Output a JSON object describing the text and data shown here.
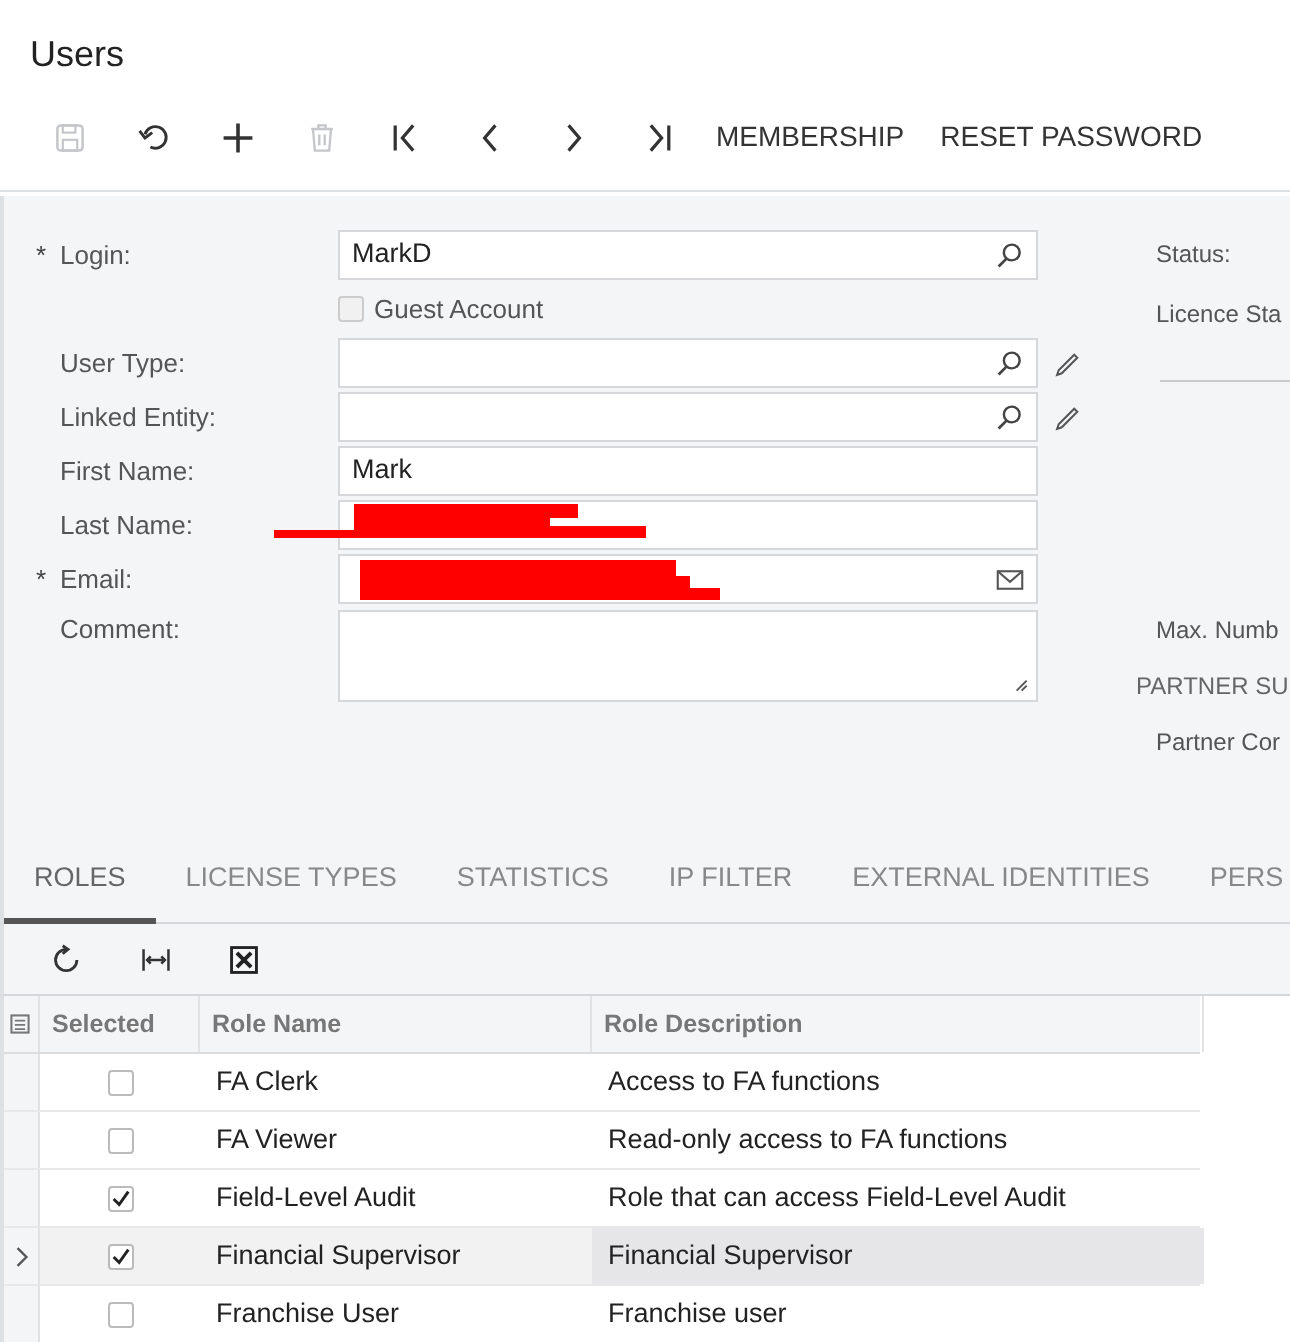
{
  "page_title": "Users",
  "toolbar": {
    "icon_buttons": [
      {
        "disabled": true
      },
      {
        "disabled": false
      },
      {
        "disabled": false
      },
      {
        "disabled": true
      },
      {
        "disabled": false
      },
      {
        "disabled": false
      },
      {
        "disabled": false
      },
      {
        "disabled": false
      }
    ],
    "text_buttons": [
      "MEMBERSHIP",
      "RESET PASSWORD"
    ]
  },
  "form": {
    "fields": [
      {
        "kind": "lookup",
        "label": "Login:",
        "required_mark": "*",
        "value": "MarkD"
      },
      {
        "kind": "checkbox",
        "label": "Guest Account",
        "checked": false,
        "disabled": true
      },
      {
        "kind": "lookup-edit",
        "label": "User Type:"
      },
      {
        "kind": "lookup-edit",
        "label": "Linked Entity:"
      },
      {
        "kind": "text",
        "label": "First Name:",
        "value": "Mark"
      },
      {
        "kind": "text",
        "label": "Last Name:",
        "redacted": true
      },
      {
        "kind": "email",
        "label": "Email:",
        "required_mark": "*",
        "redacted": true
      },
      {
        "kind": "textarea",
        "label": "Comment:"
      }
    ],
    "right_column": [
      {
        "kind": "label",
        "text": "Status:"
      },
      {
        "kind": "label",
        "text": "Licence Sta"
      },
      {
        "kind": "divider"
      },
      {
        "kind": "label",
        "text": "Max. Numb"
      },
      {
        "kind": "section",
        "text": "PARTNER SU"
      },
      {
        "kind": "label",
        "text": "Partner Cor"
      }
    ]
  },
  "tabs": [
    {
      "label": "ROLES",
      "selected": true
    },
    {
      "label": "LICENSE TYPES",
      "selected": false
    },
    {
      "label": "STATISTICS",
      "selected": false
    },
    {
      "label": "IP FILTER",
      "selected": false
    },
    {
      "label": "EXTERNAL IDENTITIES",
      "selected": false
    },
    {
      "label": "PERS",
      "selected": false
    }
  ],
  "grid": {
    "columns": [
      "Selected",
      "Role Name",
      "Role Description"
    ],
    "rows": [
      {
        "checked": false,
        "name": "FA Clerk",
        "description": "Access to FA functions",
        "selected": false
      },
      {
        "checked": false,
        "name": "FA Viewer",
        "description": "Read-only access to FA functions",
        "selected": false
      },
      {
        "checked": true,
        "name": "Field-Level Audit",
        "description": "Role that can access Field-Level Audit",
        "selected": false
      },
      {
        "checked": true,
        "name": "Financial Supervisor",
        "description": "Financial Supervisor",
        "selected": true
      },
      {
        "checked": false,
        "name": "Franchise User",
        "description": "Franchise user",
        "selected": false
      }
    ]
  }
}
